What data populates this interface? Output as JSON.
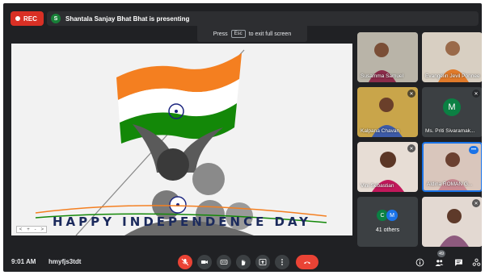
{
  "recording": {
    "label": "REC",
    "color": "#d93025"
  },
  "presenter": {
    "initial": "S",
    "text": "Shantala Sanjay Bhat Bhat is presenting"
  },
  "fullscreen_tip": {
    "before": "Press",
    "key": "Esc",
    "after": "to exit full screen"
  },
  "slide": {
    "title": "HAPPY INDEPENDENCE DAY",
    "controls": [
      "<",
      "+",
      "-",
      ">"
    ]
  },
  "participants": [
    {
      "name": "Susamma Samuel",
      "muted": false
    },
    {
      "name": "Evangelin Jevil Ponnee",
      "muted": false
    },
    {
      "name": "Kalpana Chavan",
      "muted": true
    },
    {
      "name": "Ms. Priti Sivaramak...",
      "initial": "M",
      "muted": true
    },
    {
      "name": "Vini Sebastian",
      "muted": true
    },
    {
      "name": "Aldina ROMAN G...",
      "speaking": true
    },
    {
      "name": "",
      "muted": true
    }
  ],
  "others": {
    "label": "41 others",
    "initials": [
      "C",
      "M"
    ]
  },
  "meeting": {
    "time": "9:01 AM",
    "code": "hmyfjs3tdt"
  },
  "people_count": "49",
  "icons": {
    "mic": "mic-off-icon",
    "camera": "camera-icon",
    "captions": "captions-icon",
    "hand": "raise-hand-icon",
    "present": "present-icon",
    "more": "more-icon",
    "hangup": "hangup-icon",
    "info": "info-icon",
    "people": "people-icon",
    "chat": "chat-icon",
    "activities": "activities-icon"
  },
  "colors": {
    "background": "#202124",
    "tile": "#3c4043",
    "danger": "#ea4335",
    "accent": "#1a73e8"
  }
}
